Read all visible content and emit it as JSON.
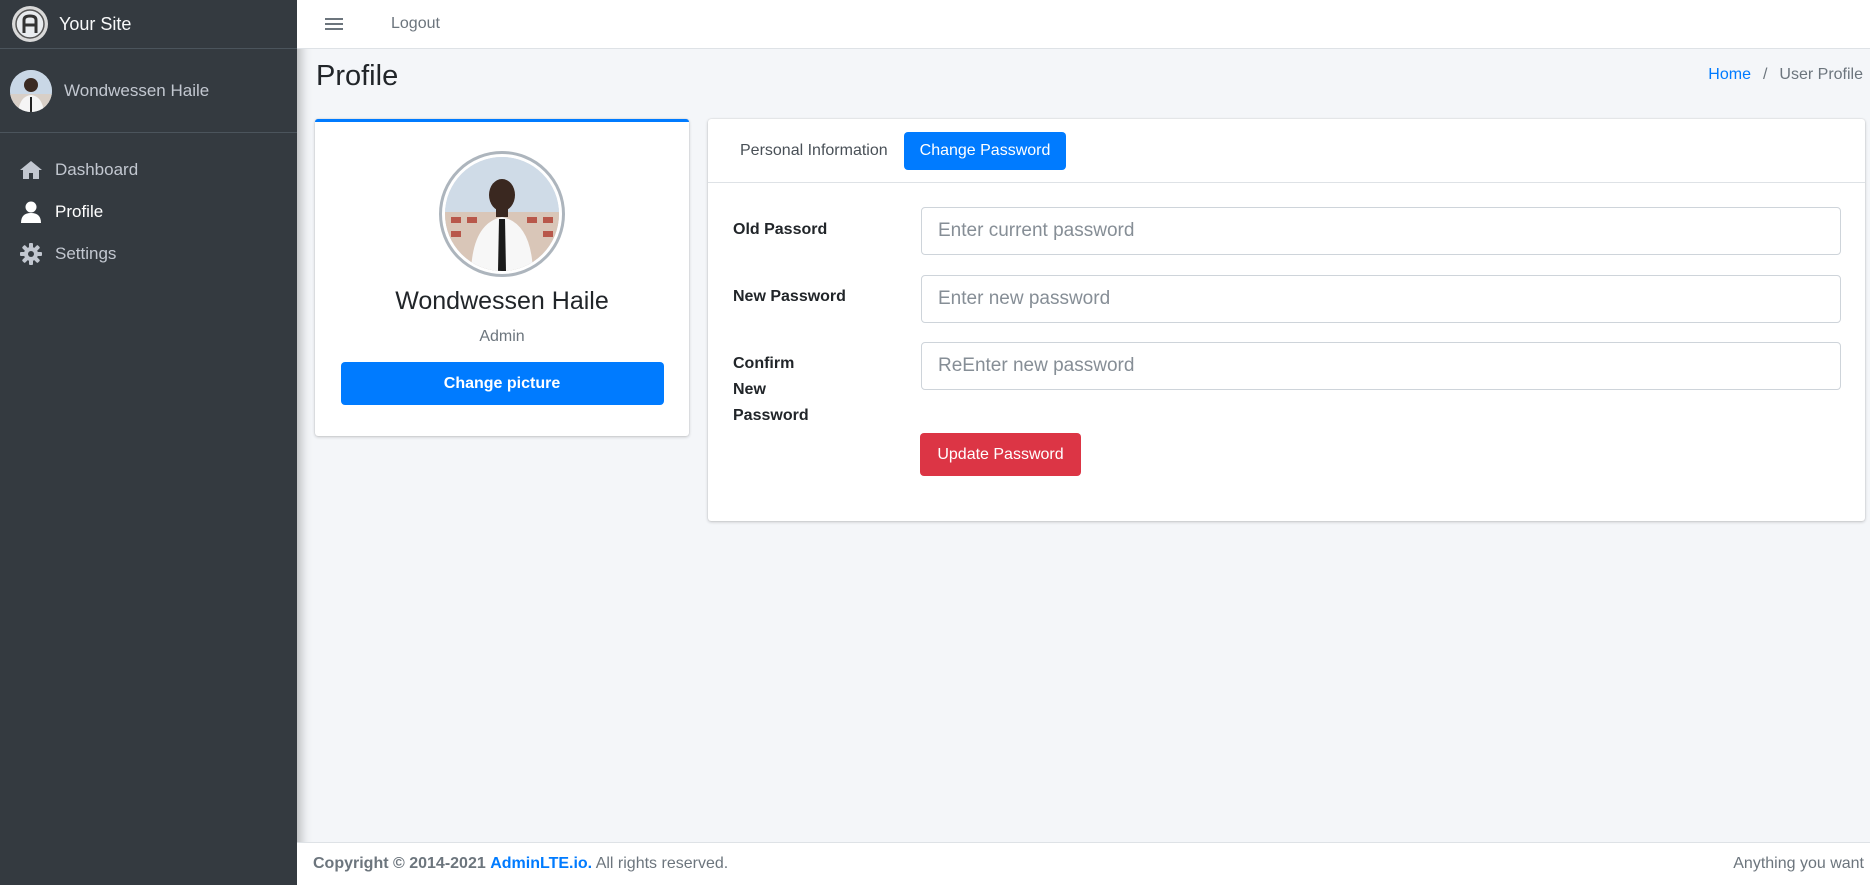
{
  "brand": {
    "name": "Your Site",
    "logo_icon": "adminlte-logo-icon"
  },
  "user_panel": {
    "name": "Wondwessen Haile"
  },
  "sidebar": {
    "items": [
      {
        "label": "Dashboard",
        "icon": "home-icon",
        "active": false
      },
      {
        "label": "Profile",
        "icon": "user-icon",
        "active": true
      },
      {
        "label": "Settings",
        "icon": "gear-icon",
        "active": false
      }
    ]
  },
  "topbar": {
    "menu_icon": "hamburger-icon",
    "logout_label": "Logout"
  },
  "header": {
    "title": "Profile"
  },
  "breadcrumb": {
    "home": "Home",
    "separator": "/",
    "current": "User Profile"
  },
  "profile_card": {
    "name": "Wondwessen Haile",
    "role": "Admin",
    "change_picture_label": "Change picture"
  },
  "password_card": {
    "tabs": [
      {
        "label": "Personal Information",
        "active": false
      },
      {
        "label": "Change Password",
        "active": true
      }
    ],
    "fields": [
      {
        "label": "Old Passord",
        "placeholder": "Enter current password",
        "value": ""
      },
      {
        "label": "New Password",
        "placeholder": "Enter new password",
        "value": ""
      },
      {
        "label": "Confirm New Password",
        "placeholder": "ReEnter new password",
        "value": ""
      }
    ],
    "submit_label": "Update Password"
  },
  "footer": {
    "copyright": "Copyright © 2014-2021",
    "link": "AdminLTE.io.",
    "rights": "All rights reserved.",
    "right_text": "Anything you want"
  },
  "colors": {
    "sidebar_bg": "#343a40",
    "primary": "#007bff",
    "danger": "#dc3545",
    "page_bg": "#f4f6f9"
  }
}
